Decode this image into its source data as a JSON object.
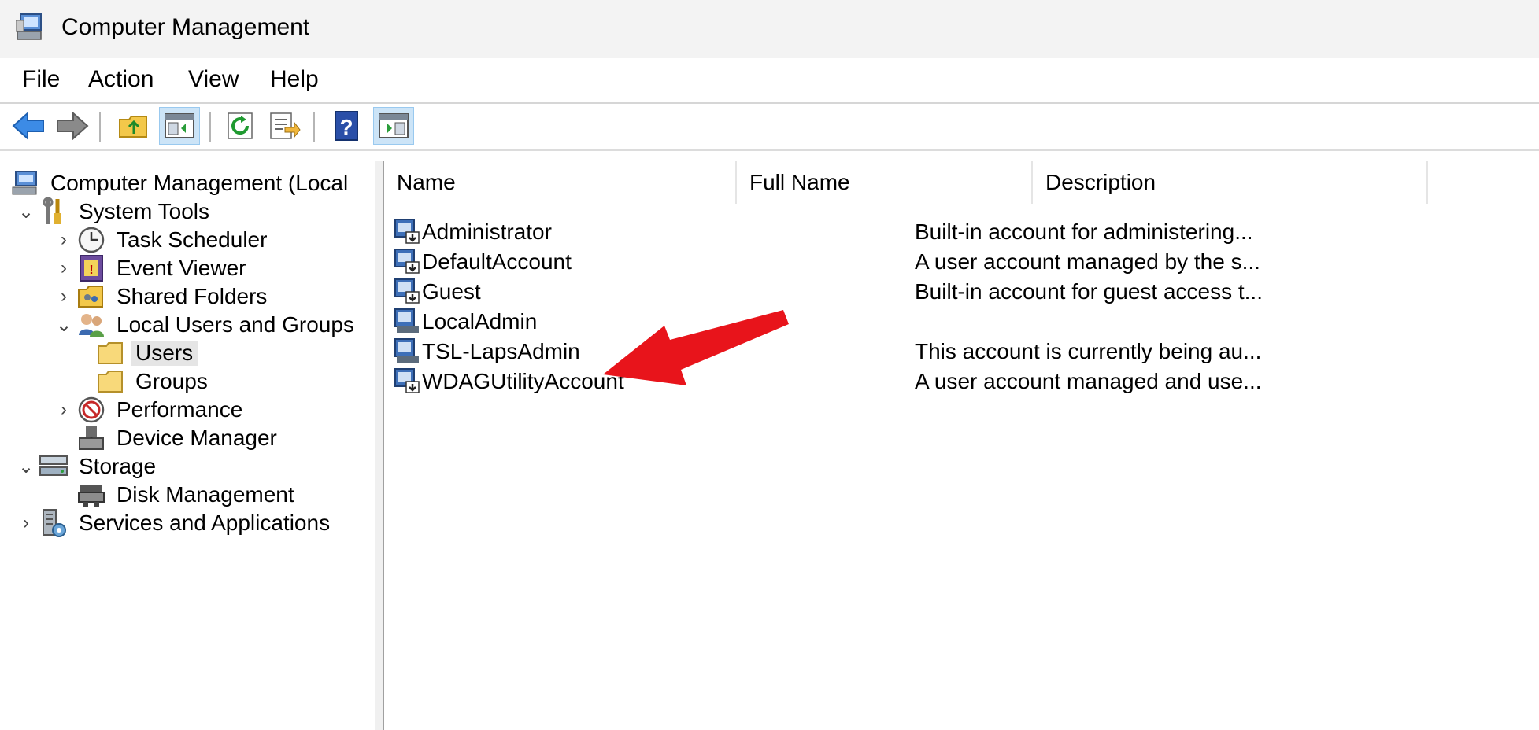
{
  "window": {
    "title": "Computer Management"
  },
  "menu": [
    "File",
    "Action",
    "View",
    "Help"
  ],
  "toolbar": {
    "buttons": [
      {
        "icon": "back-arrow-icon"
      },
      {
        "icon": "forward-arrow-icon"
      },
      {
        "icon": "up-folder-icon"
      },
      {
        "icon": "show-hide-console-tree-icon"
      },
      {
        "icon": "refresh-icon"
      },
      {
        "icon": "export-list-icon"
      },
      {
        "icon": "help-icon"
      },
      {
        "icon": "show-hide-action-pane-icon"
      }
    ]
  },
  "tree": [
    {
      "label": "Computer Management (Local",
      "icon": "computer-management-icon",
      "chevron": ""
    },
    {
      "label": "System Tools",
      "icon": "system-tools-icon",
      "chevron": "expanded"
    },
    {
      "label": "Task Scheduler",
      "icon": "clock-icon",
      "chevron": "collapsed"
    },
    {
      "label": "Event Viewer",
      "icon": "event-viewer-icon",
      "chevron": "collapsed"
    },
    {
      "label": "Shared Folders",
      "icon": "shared-folders-icon",
      "chevron": "collapsed"
    },
    {
      "label": "Local Users and Groups",
      "icon": "users-group-icon",
      "chevron": "expanded"
    },
    {
      "label": "Users",
      "icon": "folder-icon",
      "chevron": "",
      "selected": true
    },
    {
      "label": "Groups",
      "icon": "folder-icon",
      "chevron": ""
    },
    {
      "label": "Performance",
      "icon": "performance-icon",
      "chevron": "collapsed"
    },
    {
      "label": "Device Manager",
      "icon": "device-manager-icon",
      "chevron": ""
    },
    {
      "label": "Storage",
      "icon": "storage-icon",
      "chevron": "expanded"
    },
    {
      "label": "Disk Management",
      "icon": "disk-management-icon",
      "chevron": ""
    },
    {
      "label": "Services and Applications",
      "icon": "services-icon",
      "chevron": "collapsed"
    }
  ],
  "list": {
    "columns": [
      "Name",
      "Full Name",
      "Description"
    ],
    "rows": [
      {
        "name": "Administrator",
        "full_name": "",
        "description": "Built-in account for administering..."
      },
      {
        "name": "DefaultAccount",
        "full_name": "",
        "description": "A user account managed by the s..."
      },
      {
        "name": "Guest",
        "full_name": "",
        "description": "Built-in account for guest access t..."
      },
      {
        "name": "LocalAdmin",
        "full_name": "",
        "description": ""
      },
      {
        "name": "TSL-LapsAdmin",
        "full_name": "",
        "description": "This account is currently being au..."
      },
      {
        "name": "WDAGUtilityAccount",
        "full_name": "",
        "description": "A user account managed and use..."
      }
    ]
  },
  "annotation": {
    "arrow_color": "#e8141b"
  },
  "colors": {
    "selection": "#cce4f7",
    "tree_selected": "#e5e5e5"
  }
}
